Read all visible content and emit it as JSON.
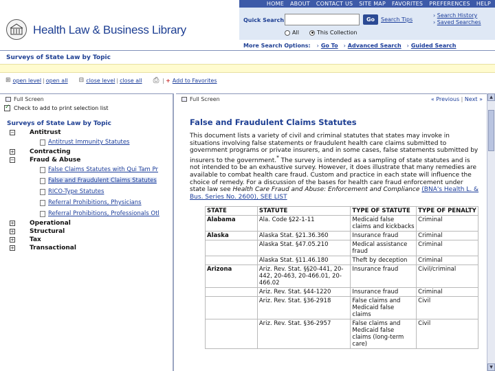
{
  "topnav": [
    "HOME",
    "ABOUT",
    "CONTACT US",
    "SITE MAP",
    "FAVORITES",
    "PREFERENCES",
    "HELP"
  ],
  "header": {
    "title": "Health Law & Business Library"
  },
  "search": {
    "label": "Quick Search",
    "placeholder": "",
    "go": "Go",
    "tips": "Search Tips",
    "history": "Search History",
    "saved": "Saved Searches",
    "scope_all": "All",
    "scope_collection": "This Collection",
    "more_label": "More Search Options:",
    "goto": "Go To",
    "advanced": "Advanced Search",
    "guided": "Guided Search"
  },
  "breadcrumb": "Surveys of State Law by Topic",
  "toolbar": {
    "open_level": "open level",
    "open_all": "open all",
    "close_level": "close level",
    "close_all": "close all",
    "add_favorites": "Add to Favorites"
  },
  "left": {
    "fullscreen": "Full Screen",
    "checkbox_label": "Check to add to print selection list",
    "tree_title": "Surveys of State Law by Topic",
    "tree": [
      {
        "label": "Antitrust",
        "toggle": "−",
        "children": [
          "Antitrust Immunity Statutes"
        ]
      },
      {
        "label": "Contracting",
        "toggle": "+",
        "children": []
      },
      {
        "label": "Fraud & Abuse",
        "toggle": "−",
        "children": [
          "False Claims Statutes with Qui Tam Pr",
          "False and Fraudulent Claims Statutes",
          "RICO-Type Statutes",
          "Referral Prohibitions, Physicians",
          "Referral Prohibitions, Professionals Otl"
        ]
      },
      {
        "label": "Operational",
        "toggle": "+",
        "children": []
      },
      {
        "label": "Structural",
        "toggle": "+",
        "children": []
      },
      {
        "label": "Tax",
        "toggle": "+",
        "children": []
      },
      {
        "label": "Transactional",
        "toggle": "+",
        "children": []
      }
    ]
  },
  "right": {
    "fullscreen": "Full Screen",
    "prev": "« Previous",
    "next": "Next »",
    "doc_title": "False and Fraudulent Claims Statutes",
    "body_1": "This document lists a variety of civil and criminal statutes that states may invoke in situations involving false statements or fraudulent health care claims submitted to government programs or private insurers, and in some cases, false statements submitted by insurers to the government.",
    "body_2": " The survey is intended as a sampling of state statutes and is not intended to be an exhaustive survey. However, it does illustrate that many remedies are available to combat health care fraud. Custom and practice in each state will influence the choice of remedy. For a discussion of the bases for health care fraud enforcement under state law see ",
    "body_ital": "Health Care Fraud and Abuse: Enforcement and Compliance",
    "body_3": " ",
    "body_link": "(BNA's Health L. & Bus. Series No. 2600),",
    "body_see": " SEE LIST",
    "table": {
      "headers": [
        "STATE",
        "STATUTE",
        "TYPE OF STATUTE",
        "TYPE OF PENALTY"
      ],
      "rows": [
        [
          "Alabama",
          "Ala. Code §22-1-11",
          "Medicaid false claims and kickbacks",
          "Criminal"
        ],
        [
          "Alaska",
          "Alaska Stat. §21.36.360",
          "Insurance fraud",
          "Criminal"
        ],
        [
          "",
          "Alaska Stat. §47.05.210",
          "Medical assistance fraud",
          "Criminal"
        ],
        [
          "",
          "Alaska Stat. §11.46.180",
          "Theft by deception",
          "Criminal"
        ],
        [
          "Arizona",
          "Ariz. Rev. Stat. §§20-441, 20-442, 20-463, 20-466.01, 20-466.02",
          "Insurance fraud",
          "Civil/criminal"
        ],
        [
          "",
          "Ariz. Rev. Stat. §44-1220",
          "Insurance fraud",
          "Criminal"
        ],
        [
          "",
          "Ariz. Rev. Stat. §36-2918",
          "False claims and Medicaid false claims",
          "Civil"
        ],
        [
          "",
          "Ariz. Rev. Stat. §36-2957",
          "False claims and Medicaid false claims (long-term care)",
          "Civil"
        ]
      ]
    }
  }
}
